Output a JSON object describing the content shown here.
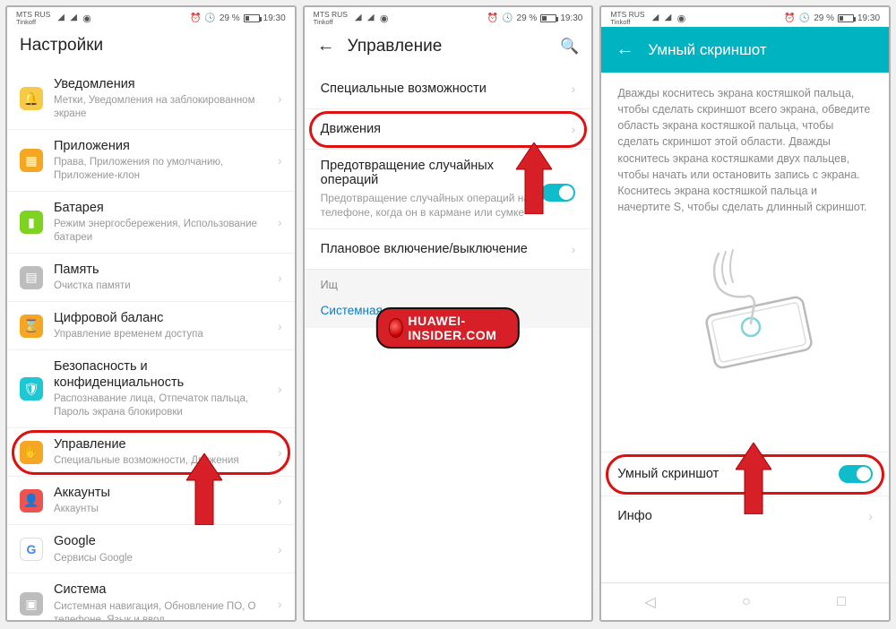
{
  "status": {
    "carrier": "MTS RUS",
    "sub": "Tinkoff",
    "battery": "29 %",
    "time": "19:30"
  },
  "colors": {
    "highlight": "#d11",
    "accent": "#0fbccc",
    "headerC": "#00b3c0"
  },
  "watermark": "HUAWEI-INSIDER.COM",
  "phoneA": {
    "title": "Настройки",
    "items": [
      {
        "title": "Уведомления",
        "sub": "Метки, Уведомления на заблокированном экране",
        "color": "#f7c948",
        "glyph": "🔔"
      },
      {
        "title": "Приложения",
        "sub": "Права, Приложения по умолчанию, Приложение-клон",
        "color": "#f5a623",
        "glyph": "▦"
      },
      {
        "title": "Батарея",
        "sub": "Режим энергосбережения, Использование батареи",
        "color": "#7ed321",
        "glyph": "▮"
      },
      {
        "title": "Память",
        "sub": "Очистка памяти",
        "color": "#bdbdbd",
        "glyph": "▤"
      },
      {
        "title": "Цифровой баланс",
        "sub": "Управление временем доступа",
        "color": "#f5a623",
        "glyph": "⌛"
      },
      {
        "title": "Безопасность и конфиденциальность",
        "sub": "Распознавание лица, Отпечаток пальца, Пароль экрана блокировки",
        "color": "#1fc7d4",
        "glyph": "🛡"
      },
      {
        "title": "Управление",
        "sub": "Специальные возможности, Движения",
        "color": "#f5a623",
        "glyph": "✋",
        "highlight": true
      },
      {
        "title": "Аккаунты",
        "sub": "Аккаунты",
        "color": "#ef5350",
        "glyph": "👤"
      },
      {
        "title": "Google",
        "sub": "Сервисы Google",
        "color": "#ffffff",
        "glyph": "G",
        "gborder": true
      },
      {
        "title": "Система",
        "sub": "Системная навигация, Обновление ПО, О телефоне, Язык и ввод",
        "color": "#bdbdbd",
        "glyph": "▣"
      }
    ]
  },
  "phoneB": {
    "title": "Управление",
    "items": {
      "accessibility": "Специальные возможности",
      "motions": "Движения",
      "prevent_title": "Предотвращение случайных операций",
      "prevent_sub": "Предотвращение случайных операций на телефоне, когда он в кармане или сумке",
      "scheduled": "Плановое включение/выключение",
      "section_hint": "Ищ",
      "section_link": "Системная навигация"
    }
  },
  "phoneC": {
    "title": "Умный скриншот",
    "desc": "Дважды коснитесь экрана костяшкой пальца, чтобы сделать скриншот всего экрана, обведите область экрана костяшкой пальца, чтобы сделать скриншот этой области. Дважды коснитесь экрана костяшками двух пальцев, чтобы начать или остановить запись с экрана. Коснитесь экрана костяшкой пальца и начертите S, чтобы сделать длинный скриншот.",
    "toggle_label": "Умный скриншот",
    "info": "Инфо"
  }
}
